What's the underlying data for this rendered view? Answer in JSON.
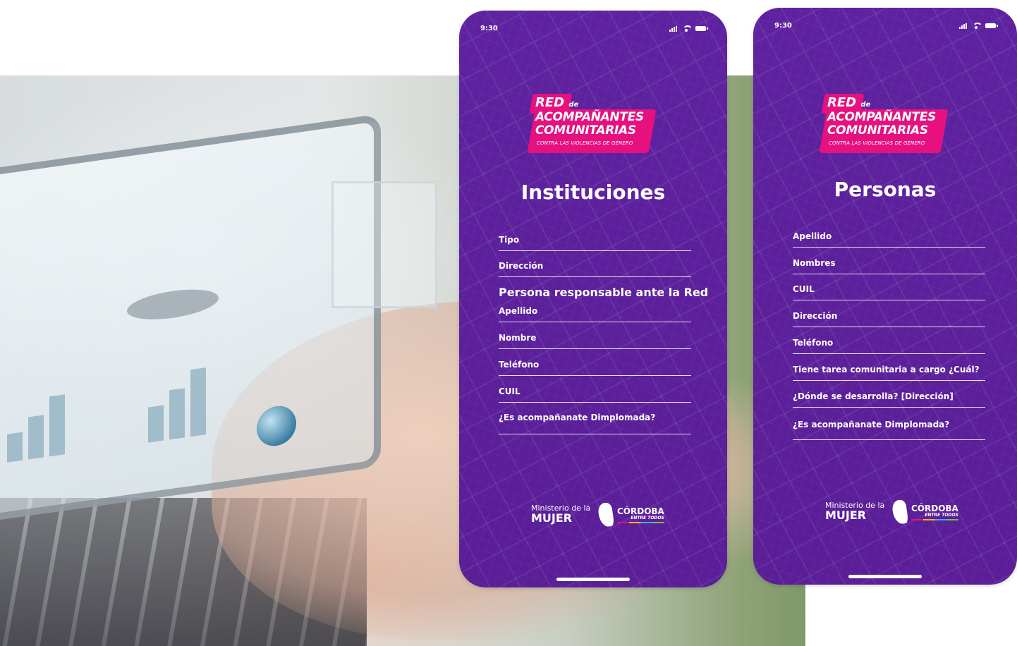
{
  "colors": {
    "phone_bg": "#5b1f9a",
    "brand_pink": "#e6117f",
    "text": "#ffffff"
  },
  "status_bar": {
    "time": "9:30"
  },
  "logo": {
    "line1": "RED",
    "line1_small": "de",
    "line2": "ACOMPAÑANTES",
    "line3": "COMUNITARIAS",
    "tagline": "CONTRA LAS VIOLENCIAS DE GÉNERO"
  },
  "footer": {
    "ministry_prefix": "Ministerio de la",
    "ministry_name": "MUJER",
    "province": "CÓRDOBA",
    "province_tagline": "ENTRE TODOS"
  },
  "instituciones": {
    "title": "Instituciones",
    "fields": [
      "Tipo",
      "Dirección"
    ],
    "section": "Persona responsable ante la Red",
    "section_fields": [
      "Apellido",
      "Nombre",
      "Teléfono",
      "CUIL",
      "¿Es acompañanate Dimplomada?"
    ]
  },
  "personas": {
    "title": "Personas",
    "fields": [
      "Apellido",
      "Nombres",
      "CUIL",
      "Dirección",
      "Teléfono",
      "Tiene tarea comunitaria a cargo ¿Cuál?",
      "¿Dónde se desarrolla? [Dirección]",
      "¿Es acompañanate Dimplomada?"
    ]
  }
}
